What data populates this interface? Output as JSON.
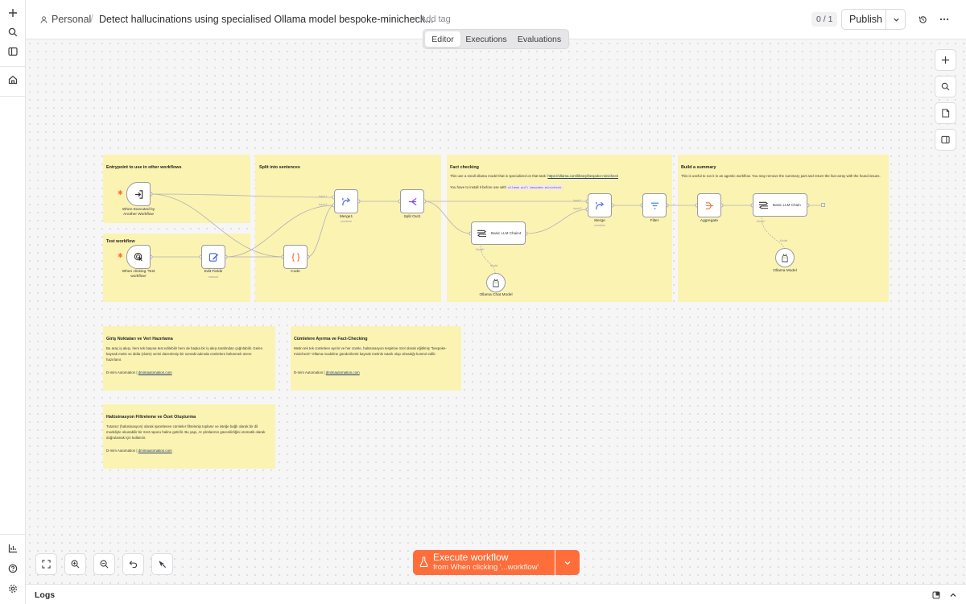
{
  "header": {
    "project": "Personal",
    "breadcrumb_sep": "/",
    "workflow_title": "Detect hallucinations using specialised Ollama model bespoke-minicheck...",
    "add_tag": "+ Add tag",
    "counter": "0 / 1",
    "publish": "Publish"
  },
  "tabs": [
    {
      "label": "Editor",
      "active": true
    },
    {
      "label": "Executions",
      "active": false
    },
    {
      "label": "Evaluations",
      "active": false
    }
  ],
  "stickies": {
    "entrypoint": {
      "title": "Entrypoint to use in other workflows"
    },
    "test": {
      "title": "Test workflow"
    },
    "split": {
      "title": "Split into sentences"
    },
    "fact": {
      "title": "Fact checking",
      "line1": "This use a small ollama model that is specialized on that task:",
      "link": "https://ollama.com/library/bespoke-minicheck",
      "line2": "You have to install it before use with",
      "code": "ollama pull bespoke-minicheck",
      "line2_end": "."
    },
    "summary": {
      "title": "Build a summary",
      "text": "This is useful to run it in an agentic workflow. You may remove the summary part and return the fact array with the found issues."
    },
    "note1": {
      "title": "Giriş Noktaları ve Veri Hazırlama",
      "text": "Bu araç iş akışı, hem tek başına test edilebilir hem de başka bir iş akışı tarafından çağrılabilir. Gelen kaynak metin ve iddia (claim) verisi düzenlenip bir sonraki adımda cümlelere bölünmek üzere hazırlanır.",
      "footer": "D-mim Automation |",
      "link": "dmimautomation.com"
    },
    "note2": {
      "title": "Cümlelere Ayırma ve Fact-Checking",
      "text": "Metin tek tek cümlelere ayrılır ve her cümle, halüsinasyon tespitine özel olarak eğitilmiş \"bespoke-minicheck\" Ollama modeline gönderilerek kaynak metinle tutarlı olup olmadığı kontrol edilir.",
      "footer": "D-mim Automation |",
      "link": "dmimautomation.com"
    },
    "note3": {
      "title": "Halüsinasyon Filtreleme ve Özet Oluşturma",
      "text": "Tutarsız (halüsinasyon) olarak işaretlenen cümleler filtrelenip toplanır ve isteğe bağlı olarak bir dil modeliyle okunabilir bir özet raporu haline getirilir. Bu yapı, AI çıktılarının güvenilirliğini otomatik olarak doğrulamak için kullanılır.",
      "footer": "D-mim Automation |",
      "link": "dmimautomation.com"
    }
  },
  "nodes": {
    "exec_by": {
      "label": "When Executed by Another Workflow",
      "icon": "arrow-into-box-icon"
    },
    "manual": {
      "label": "When clicking 'Test workflow'",
      "icon": "pointer-click-icon"
    },
    "edit_fields": {
      "label": "Edit Fields",
      "sub": "manual",
      "icon": "pencil-icon"
    },
    "code": {
      "label": "Code",
      "icon": "braces-icon"
    },
    "merge1": {
      "label": "Merge1",
      "sub": "combine",
      "icon": "merge-icon"
    },
    "split_out": {
      "label": "Split Out1",
      "icon": "split-icon"
    },
    "llm4": {
      "label": "Basic LLM Chain4",
      "icon": "chain-icon"
    },
    "ollama_chat": {
      "label": "Ollama Chat Model",
      "icon": "ollama-icon"
    },
    "merge": {
      "label": "Merge",
      "sub": "combine",
      "icon": "merge-icon"
    },
    "filter": {
      "label": "Filter",
      "icon": "filter-icon"
    },
    "aggregate": {
      "label": "Aggregate",
      "icon": "aggregate-icon"
    },
    "llm": {
      "label": "Basic LLM Chain",
      "icon": "chain-icon"
    },
    "ollama_model": {
      "label": "Ollama Model",
      "icon": "ollama-icon"
    }
  },
  "ports": {
    "input1": "Input 1",
    "input2": "Input 2",
    "model": "Model",
    "model_req": "Model*"
  },
  "execute": {
    "label": "Execute workflow",
    "sub": "from When clicking '...workflow'"
  },
  "logs": {
    "label": "Logs"
  },
  "colors": {
    "accent": "#ff6d3a",
    "sticky": "#fbf3b2"
  }
}
